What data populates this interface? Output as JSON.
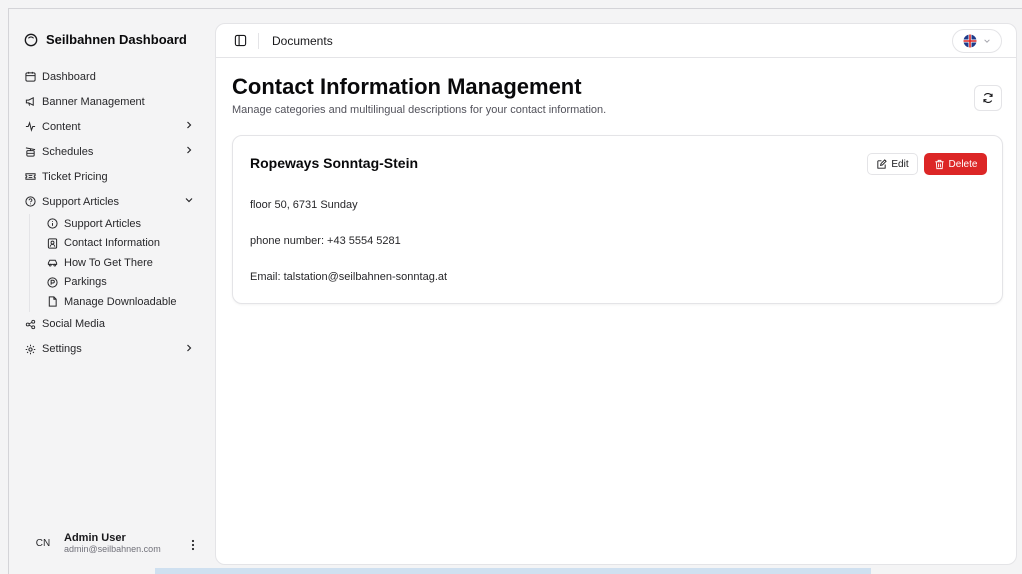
{
  "sidebar": {
    "brand": "Seilbahnen Dashboard",
    "items": [
      {
        "label": "Dashboard",
        "icon": "calendar-icon"
      },
      {
        "label": "Banner Management",
        "icon": "megaphone-icon"
      },
      {
        "label": "Content",
        "icon": "activity-icon",
        "chevron": "right"
      },
      {
        "label": "Schedules",
        "icon": "cable-car-icon",
        "chevron": "right"
      },
      {
        "label": "Ticket Pricing",
        "icon": "ticket-icon"
      },
      {
        "label": "Support Articles",
        "icon": "help-circle-icon",
        "chevron": "down"
      }
    ],
    "sub_items": [
      {
        "label": "Support Articles",
        "icon": "info-icon"
      },
      {
        "label": "Contact Information",
        "icon": "contact-icon"
      },
      {
        "label": "How To Get There",
        "icon": "car-icon"
      },
      {
        "label": "Parkings",
        "icon": "parking-icon"
      },
      {
        "label": "Manage Downloadable",
        "icon": "file-icon"
      }
    ],
    "items_after": [
      {
        "label": "Social Media",
        "icon": "share-icon"
      },
      {
        "label": "Settings",
        "icon": "gear-icon",
        "chevron": "right"
      }
    ],
    "user": {
      "initials": "CN",
      "name": "Admin User",
      "email": "admin@seilbahnen.com"
    }
  },
  "header": {
    "breadcrumb": "Documents"
  },
  "main": {
    "title": "Contact Information Management",
    "subtitle": "Manage categories and multilingual descriptions for your contact information."
  },
  "card": {
    "title": "Ropeways Sonntag-Stein",
    "edit_label": "Edit",
    "delete_label": "Delete",
    "lines": [
      "floor 50, 6731 Sunday",
      "phone number: +43 5554 5281",
      "Email: talstation@seilbahnen-sonntag.at"
    ]
  },
  "colors": {
    "accent_danger": "#dc2626",
    "border": "#e4e4e7"
  }
}
